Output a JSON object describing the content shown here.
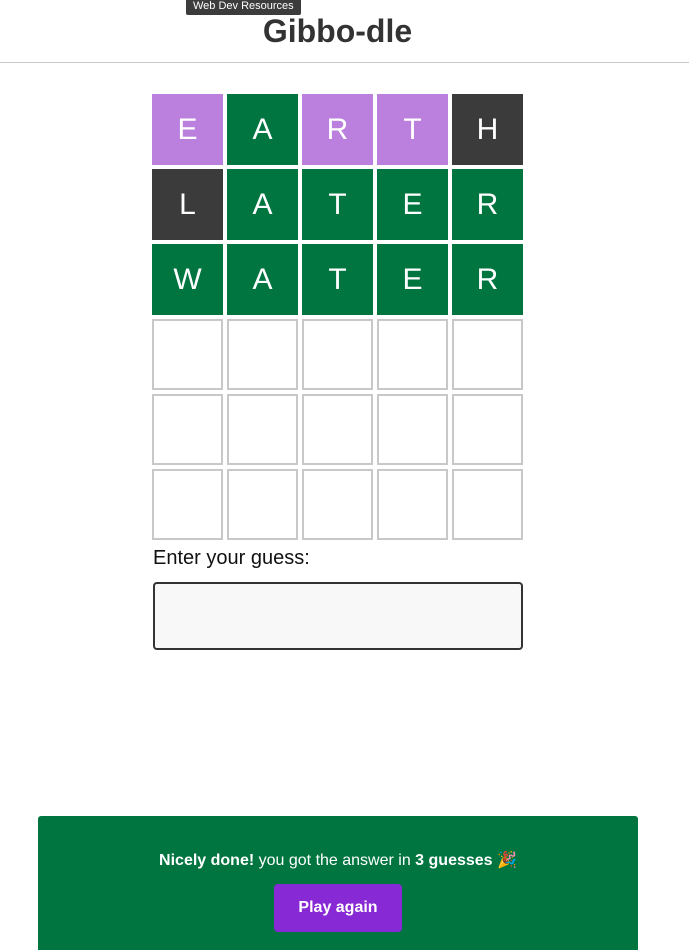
{
  "tooltip": "Web Dev Resources",
  "header": {
    "title": "Gibbo-dle"
  },
  "board": {
    "rows": [
      [
        {
          "letter": "E",
          "state": "present"
        },
        {
          "letter": "A",
          "state": "correct"
        },
        {
          "letter": "R",
          "state": "present"
        },
        {
          "letter": "T",
          "state": "present"
        },
        {
          "letter": "H",
          "state": "absent"
        }
      ],
      [
        {
          "letter": "L",
          "state": "absent"
        },
        {
          "letter": "A",
          "state": "correct"
        },
        {
          "letter": "T",
          "state": "correct"
        },
        {
          "letter": "E",
          "state": "correct"
        },
        {
          "letter": "R",
          "state": "correct"
        }
      ],
      [
        {
          "letter": "W",
          "state": "correct"
        },
        {
          "letter": "A",
          "state": "correct"
        },
        {
          "letter": "T",
          "state": "correct"
        },
        {
          "letter": "E",
          "state": "correct"
        },
        {
          "letter": "R",
          "state": "correct"
        }
      ],
      [
        {
          "letter": "",
          "state": "empty"
        },
        {
          "letter": "",
          "state": "empty"
        },
        {
          "letter": "",
          "state": "empty"
        },
        {
          "letter": "",
          "state": "empty"
        },
        {
          "letter": "",
          "state": "empty"
        }
      ],
      [
        {
          "letter": "",
          "state": "empty"
        },
        {
          "letter": "",
          "state": "empty"
        },
        {
          "letter": "",
          "state": "empty"
        },
        {
          "letter": "",
          "state": "empty"
        },
        {
          "letter": "",
          "state": "empty"
        }
      ],
      [
        {
          "letter": "",
          "state": "empty"
        },
        {
          "letter": "",
          "state": "empty"
        },
        {
          "letter": "",
          "state": "empty"
        },
        {
          "letter": "",
          "state": "empty"
        },
        {
          "letter": "",
          "state": "empty"
        }
      ]
    ]
  },
  "guess": {
    "label": "Enter your guess:",
    "value": ""
  },
  "banner": {
    "bold_prefix": "Nicely done!",
    "middle": " you got the answer in ",
    "bold_count": "3 guesses",
    "emoji": "🎉",
    "play_again_label": "Play again"
  },
  "colors": {
    "correct": "#007540",
    "present": "#bb80dd",
    "absent": "#3b3b3b",
    "button": "#8829d6"
  }
}
